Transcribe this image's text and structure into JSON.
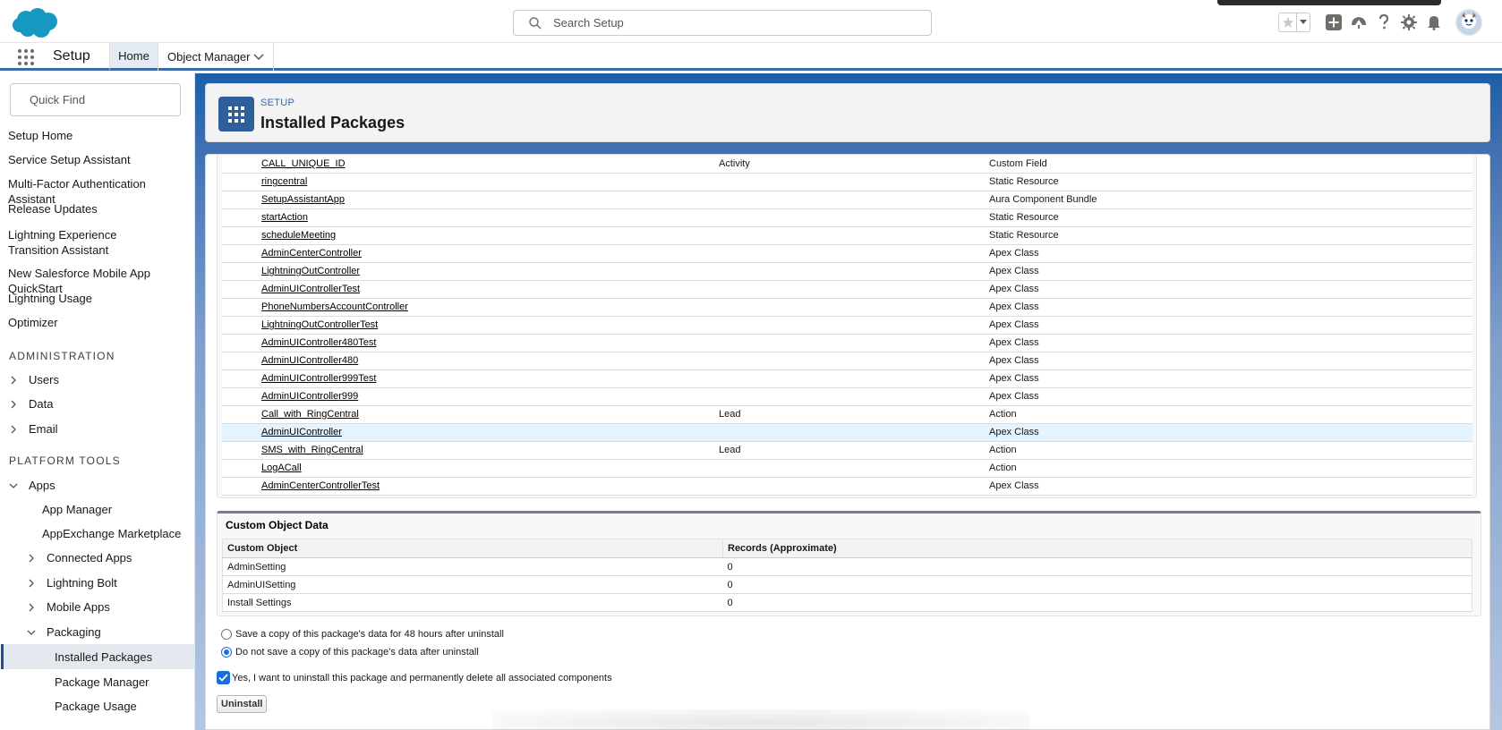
{
  "header": {
    "search_placeholder": "Search Setup"
  },
  "nav": {
    "app_name": "Setup",
    "tabs": [
      {
        "label": "Home"
      },
      {
        "label": "Object Manager"
      }
    ]
  },
  "sidebar": {
    "quick_find_placeholder": "Quick Find",
    "top_items": [
      "Setup Home",
      "Service Setup Assistant",
      "Multi-Factor Authentication Assistant",
      "Release Updates",
      "Lightning Experience Transition Assistant",
      "New Salesforce Mobile App QuickStart",
      "Lightning Usage",
      "Optimizer"
    ],
    "administration_label": "ADMINISTRATION",
    "administration_items": [
      "Users",
      "Data",
      "Email"
    ],
    "platform_tools_label": "PLATFORM TOOLS",
    "apps_label": "Apps",
    "apps_children": [
      "App Manager",
      "AppExchange Marketplace",
      "Connected Apps",
      "Lightning Bolt",
      "Mobile Apps",
      "Packaging"
    ],
    "packaging_children": [
      "Installed Packages",
      "Package Manager",
      "Package Usage"
    ]
  },
  "page_header": {
    "eyebrow": "SETUP",
    "title": "Installed Packages"
  },
  "components": [
    {
      "name": "CALL_UNIQUE_ID",
      "parent": "Activity",
      "type": "Custom Field"
    },
    {
      "name": "ringcentral",
      "parent": "",
      "type": "Static Resource"
    },
    {
      "name": "SetupAssistantApp",
      "parent": "",
      "type": "Aura Component Bundle"
    },
    {
      "name": "startAction",
      "parent": "",
      "type": "Static Resource"
    },
    {
      "name": "scheduleMeeting",
      "parent": "",
      "type": "Static Resource"
    },
    {
      "name": "AdminCenterController",
      "parent": "",
      "type": "Apex Class"
    },
    {
      "name": "LightningOutController",
      "parent": "",
      "type": "Apex Class"
    },
    {
      "name": "AdminUIControllerTest",
      "parent": "",
      "type": "Apex Class"
    },
    {
      "name": "PhoneNumbersAccountController",
      "parent": "",
      "type": "Apex Class"
    },
    {
      "name": "LightningOutControllerTest",
      "parent": "",
      "type": "Apex Class"
    },
    {
      "name": "AdminUIController480Test",
      "parent": "",
      "type": "Apex Class"
    },
    {
      "name": "AdminUIController480",
      "parent": "",
      "type": "Apex Class"
    },
    {
      "name": "AdminUIController999Test",
      "parent": "",
      "type": "Apex Class"
    },
    {
      "name": "AdminUIController999",
      "parent": "",
      "type": "Apex Class"
    },
    {
      "name": "Call_with_RingCentral",
      "parent": "Lead",
      "type": "Action"
    },
    {
      "name": "AdminUIController",
      "parent": "",
      "type": "Apex Class"
    },
    {
      "name": "SMS_with_RingCentral",
      "parent": "Lead",
      "type": "Action"
    },
    {
      "name": "LogACall",
      "parent": "",
      "type": "Action"
    },
    {
      "name": "AdminCenterControllerTest",
      "parent": "",
      "type": "Apex Class"
    }
  ],
  "custom_object_data": {
    "title": "Custom Object Data",
    "columns": [
      "Custom Object",
      "Records (Approximate)"
    ],
    "rows": [
      {
        "object": "AdminSetting",
        "records": "0"
      },
      {
        "object": "AdminUISetting",
        "records": "0"
      },
      {
        "object": "Install Settings",
        "records": "0"
      }
    ]
  },
  "uninstall": {
    "option_save": "Save a copy of this package's data for 48 hours after uninstall",
    "option_nosave": "Do not save a copy of this package's data after uninstall",
    "confirm": "Yes, I want to uninstall this package and permanently delete all associated components",
    "button": "Uninstall"
  },
  "colors": {
    "brand_blue": "#1b5fa8",
    "accent": "#1a6ddb",
    "highlight_row": "#e3f3ff"
  }
}
